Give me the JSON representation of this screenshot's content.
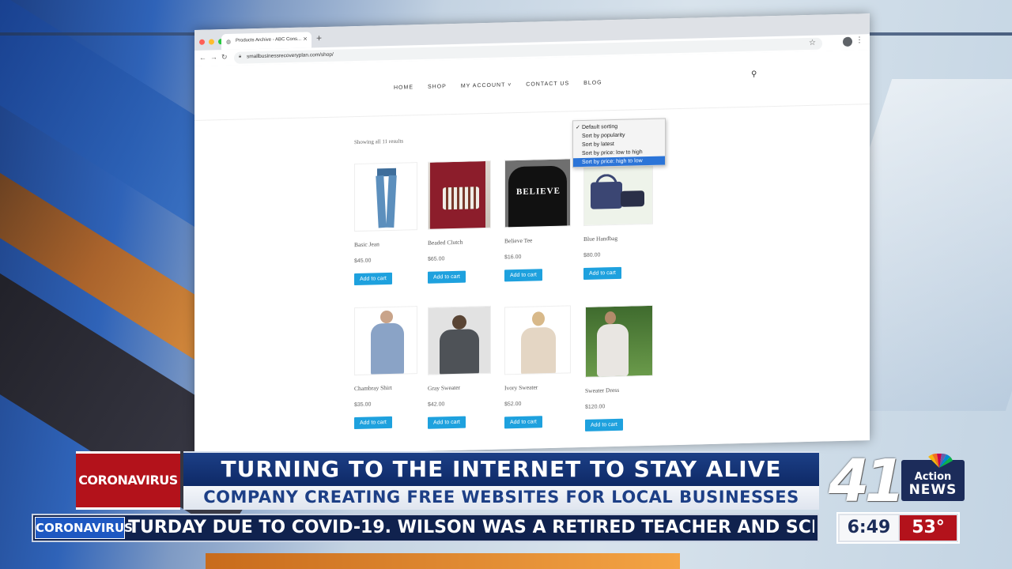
{
  "browser": {
    "tab_title": "Products Archive - ABC Cons...",
    "url": "smallbusinessrecoveryplan.com/shop/"
  },
  "site": {
    "nav": [
      "HOME",
      "SHOP",
      "MY ACCOUNT ˅",
      "CONTACT US",
      "BLOG"
    ],
    "results_text": "Showing all 11 results",
    "sort_options": [
      "Default sorting",
      "Sort by popularity",
      "Sort by latest",
      "Sort by price: low to high",
      "Sort by price: high to low"
    ],
    "sort_selected_check": "✓",
    "add_to_cart_label": "Add to cart",
    "products": [
      {
        "name": "Basic Jean",
        "price": "$45.00"
      },
      {
        "name": "Beaded Clutch",
        "price": "$65.00"
      },
      {
        "name": "Believe Tee",
        "price": "$16.00"
      },
      {
        "name": "Blue Handbag",
        "price": "$80.00"
      },
      {
        "name": "Chambray Shirt",
        "price": "$35.00"
      },
      {
        "name": "Gray Sweater",
        "price": "$42.00"
      },
      {
        "name": "Ivory Sweater",
        "price": "$52.00"
      },
      {
        "name": "Sweater Dress",
        "price": "$120.00"
      }
    ],
    "tee_print": "BELIEVE"
  },
  "broadcast": {
    "category_label": "CORONAVIRUS",
    "headline": "TURNING TO THE INTERNET TO STAY ALIVE",
    "subhead": "COMPANY CREATING FREE WEBSITES FOR LOCAL BUSINESSES",
    "ticker_tag": "CORONAVIRUS",
    "ticker_text": "TURDAY DUE TO COVID-19. WILSON WAS A RETIRED TEACHER AND SCHOOL SUPERINTE",
    "logo_number": "41",
    "logo_action": "Action",
    "logo_news": "NEWS",
    "time": "6:49",
    "temperature": "53°"
  },
  "colors": {
    "accent_blue": "#1ea1de",
    "headline_navy": "#1c3f86",
    "alert_red": "#b3121b"
  }
}
